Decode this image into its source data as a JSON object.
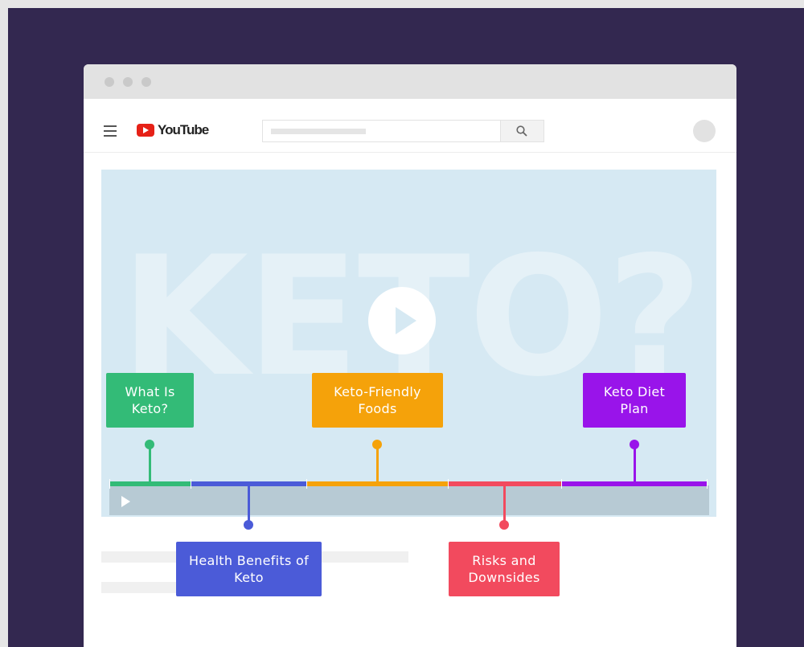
{
  "app": {
    "brand": "YouTube"
  },
  "video": {
    "background_word": "KETO?"
  },
  "chapters": [
    {
      "label": "What Is Keto?",
      "color": "#33bb77"
    },
    {
      "label": "Health Benefits of Keto",
      "color": "#4b5bd8"
    },
    {
      "label": "Keto-Friendly Foods",
      "color": "#f5a20a"
    },
    {
      "label": "Risks and Downsides",
      "color": "#f24a5e"
    },
    {
      "label": "Keto Diet Plan",
      "color": "#9914ea"
    }
  ],
  "colors": {
    "frame": "#332850",
    "video_bg": "#d6e9f3",
    "controls": "#b7cad4"
  }
}
